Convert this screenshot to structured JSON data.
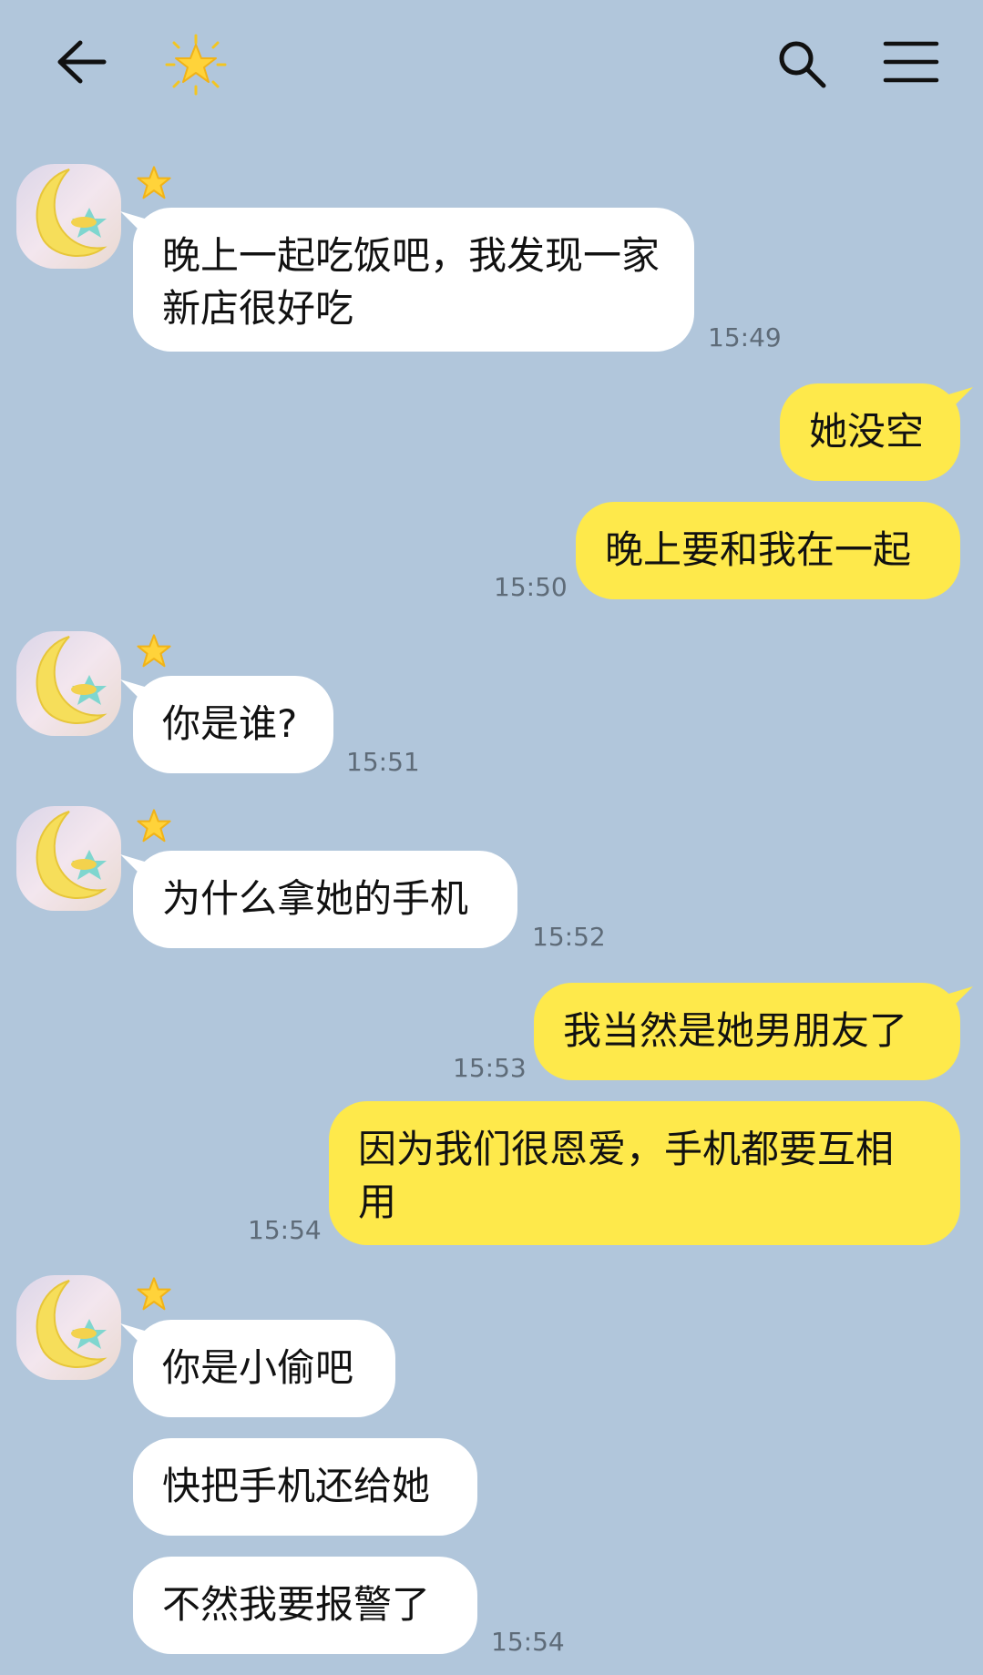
{
  "header": {
    "back_icon": "back-arrow-icon",
    "title_icon": "star-emoji-icon",
    "search_icon": "search-icon",
    "menu_icon": "hamburger-menu-icon"
  },
  "colors": {
    "background": "#b1c6db",
    "incoming_bubble": "#ffffff",
    "outgoing_bubble": "#fee94b",
    "timestamp": "#5e6b78"
  },
  "messages": [
    {
      "side": "in",
      "text": "晚上一起吃饭吧，我发现一家新店很好吃",
      "time": "15:49"
    },
    {
      "side": "out",
      "text": "她没空",
      "time": ""
    },
    {
      "side": "out",
      "text": "晚上要和我在一起",
      "time": "15:50"
    },
    {
      "side": "in",
      "text": "你是谁?",
      "time": "15:51"
    },
    {
      "side": "in",
      "text": "为什么拿她的手机",
      "time": "15:52"
    },
    {
      "side": "out",
      "text": "我当然是她男朋友了",
      "time": "15:53"
    },
    {
      "side": "out",
      "text": "因为我们很恩爱，手机都要互相用",
      "time": "15:54"
    },
    {
      "side": "in",
      "text": "你是小偷吧",
      "time": ""
    },
    {
      "side": "in",
      "text": "快把手机还给她",
      "time": ""
    },
    {
      "side": "in",
      "text": "不然我要报警了",
      "time": "15:54"
    }
  ]
}
